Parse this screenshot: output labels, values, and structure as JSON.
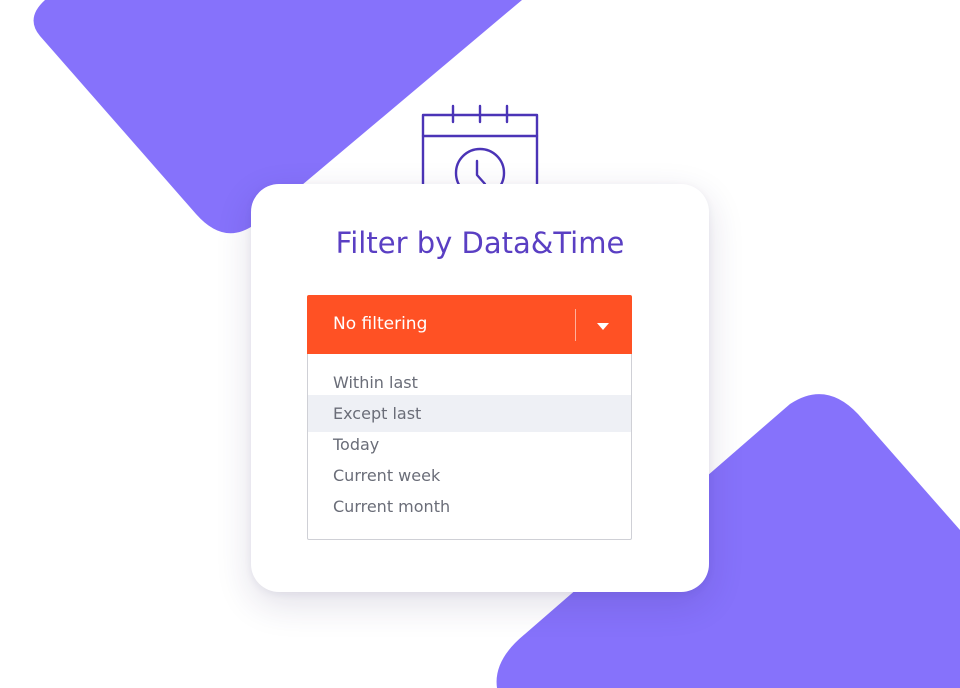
{
  "filter": {
    "title": "Filter by Data&Time",
    "selected_value": "No filtering",
    "options": [
      {
        "label": "Within last"
      },
      {
        "label": "Except last"
      },
      {
        "label": "Today"
      },
      {
        "label": "Current week"
      },
      {
        "label": "Current month"
      }
    ],
    "hovered_option": "Except last"
  },
  "colors": {
    "accent": "#ff5124",
    "brand_purple": "#5a3fc3",
    "background_shape": "#8672fb",
    "hover_row": "#eef0f5"
  },
  "icons": {
    "illustration": "calendar-clock-icon",
    "dropdown_toggle": "triangle-down-icon"
  }
}
